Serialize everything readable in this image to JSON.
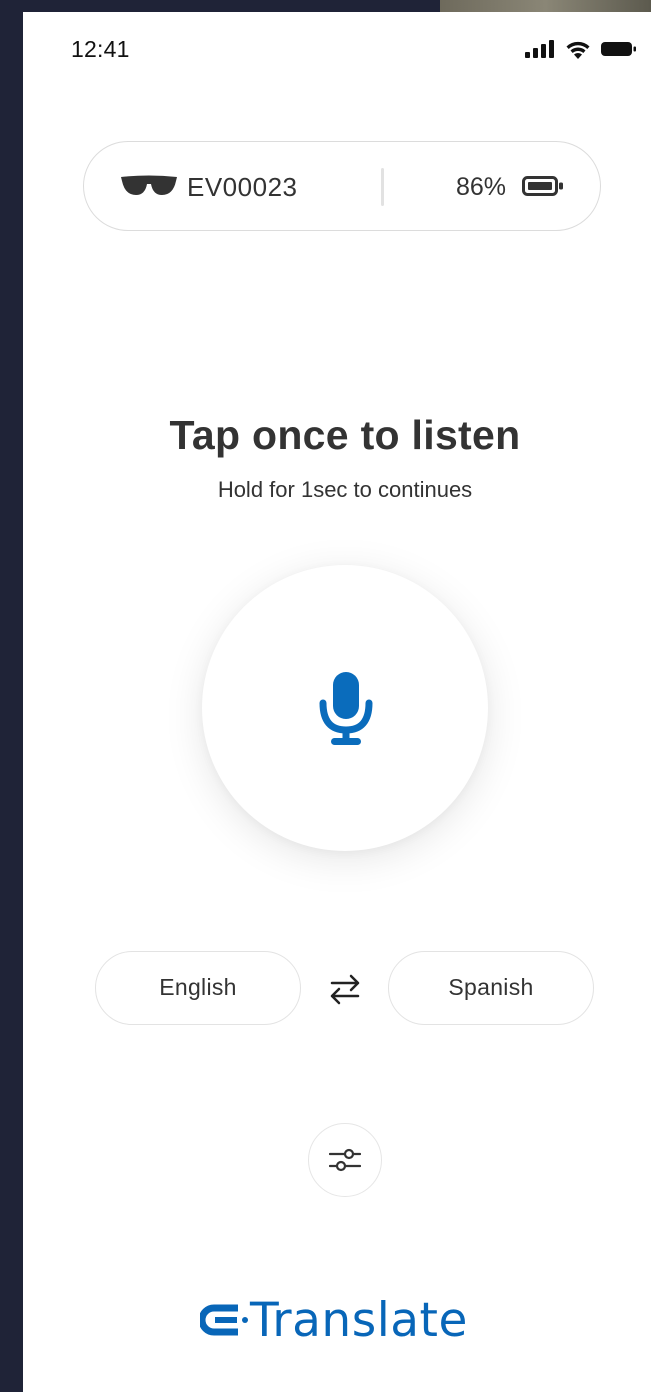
{
  "status_bar": {
    "time": "12:41"
  },
  "device": {
    "id": "EV00023",
    "battery": "86%",
    "icon": "sunglasses-icon"
  },
  "prompt": {
    "title": "Tap once to listen",
    "subtitle": "Hold for 1sec to continues"
  },
  "languages": {
    "source": "English",
    "target": "Spanish"
  },
  "brand": {
    "name": "Translate",
    "color": "#0866b8"
  },
  "colors": {
    "accent": "#0a6cbc",
    "text": "#333333"
  }
}
